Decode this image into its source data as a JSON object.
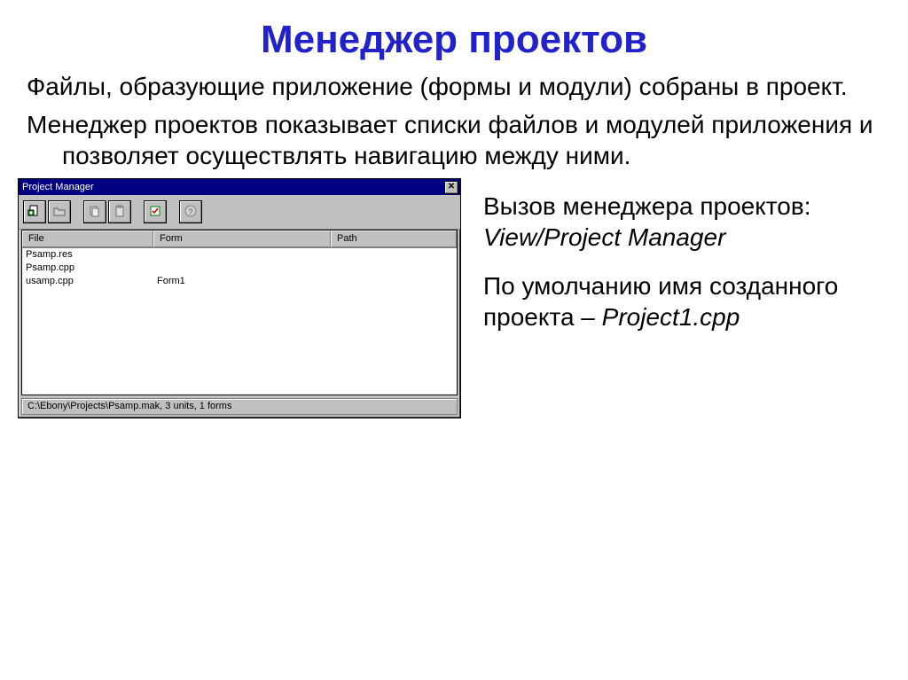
{
  "slide": {
    "title": "Менеджер проектов",
    "para1": "Файлы, образующие приложение (формы и модули) собраны в проект.",
    "para2": "Менеджер проектов показывает списки файлов и модулей приложения и позволяет осуществлять навигацию между ними.",
    "right": {
      "call_label": "Вызов менеджера проектов:",
      "call_path": "View/Project Manager",
      "default_label": "По умолчанию имя созданного проекта –",
      "default_name": "Project1.cpp"
    }
  },
  "pm": {
    "title": "Project Manager",
    "toolbar_icons": [
      "add-file-icon",
      "open-icon",
      "copy-icon",
      "paste-icon",
      "options-icon",
      "help-icon"
    ],
    "columns": {
      "file": "File",
      "form": "Form",
      "path": "Path"
    },
    "rows": [
      {
        "file": "Psamp.res",
        "form": "",
        "path": ""
      },
      {
        "file": "Psamp.cpp",
        "form": "",
        "path": ""
      },
      {
        "file": "usamp.cpp",
        "form": "Form1",
        "path": ""
      }
    ],
    "status": "C:\\Ebony\\Projects\\Psamp.mak, 3 units, 1 forms"
  }
}
